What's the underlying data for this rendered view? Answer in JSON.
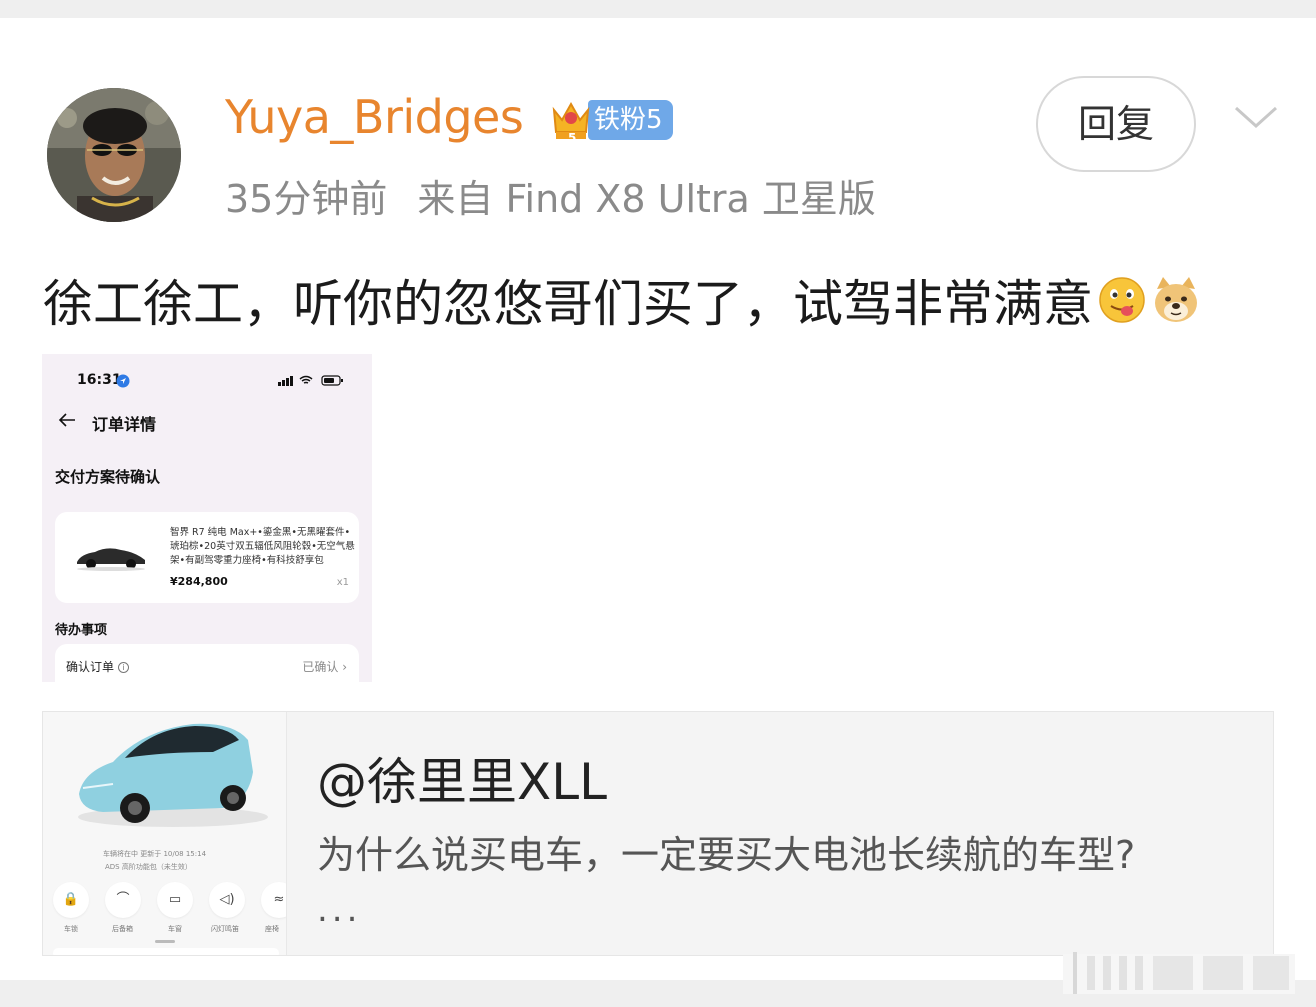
{
  "post": {
    "username": "Yuya_Bridges",
    "fan_badge": {
      "level_number": "5",
      "label": "铁粉5"
    },
    "time_ago": "35分钟前",
    "source": "来自 Find X8 Ultra 卫星版",
    "reply_label": "回复",
    "text": "徐工徐工，听你的忽悠哥们买了，试驾非常满意",
    "emojis": [
      "tongue-out-emoji",
      "doge-emoji"
    ]
  },
  "screenshot": {
    "time": "16:31",
    "title": "订单详情",
    "section1": "交付方案待确认",
    "product_desc": "智界 R7 纯电 Max+•鎏金黑•无黑曜套件•琥珀棕•20英寸双五辐低风阻轮毂•无空气悬架•有副驾零重力座椅•有科技舒享包",
    "price": "¥284,800",
    "qty": "x1",
    "section2": "待办事项",
    "row_label": "确认订单",
    "row_info": "i",
    "row_status": "已确认"
  },
  "repost": {
    "author": "@徐里里XLL",
    "excerpt": "为什么说买电车，一定要买大电池长续航的车型?",
    "more": "..."
  },
  "thumb": {
    "line1": "车辆将在中 更新于 10/08 15:14",
    "line2": "ADS 高阶功能包（未生效）",
    "icons": [
      {
        "name": "lock-icon",
        "glyph": "🔒",
        "label": "车锁"
      },
      {
        "name": "seat-icon",
        "glyph": "⌒",
        "label": "后备箱"
      },
      {
        "name": "window-icon",
        "glyph": "▭",
        "label": "车窗"
      },
      {
        "name": "horn-icon",
        "glyph": "◁)",
        "label": "闪灯鸣笛"
      },
      {
        "name": "cooling-icon",
        "glyph": "≈",
        "label": "座椅"
      }
    ]
  },
  "colors": {
    "username": "#e8852e",
    "badge_blue": "#6fa8e8",
    "meta_gray": "#8a8a8a"
  }
}
